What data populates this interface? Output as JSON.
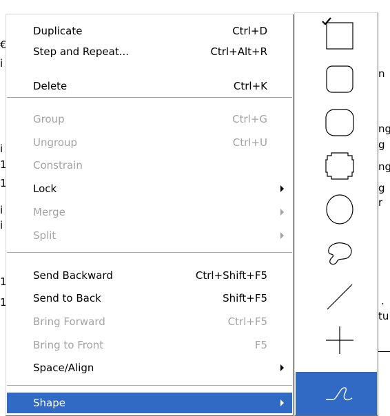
{
  "background_text": {
    "left_chars": [
      "€",
      "i",
      "i",
      "i",
      "i",
      "1",
      "1",
      "1",
      "1"
    ],
    "right_chars": [
      "n",
      "ng",
      "g",
      "ng",
      "g",
      "r",
      ".",
      "tu"
    ]
  },
  "menu": {
    "items": [
      {
        "label": "Duplicate",
        "shortcut": "Ctrl+D",
        "enabled": true
      },
      {
        "label": "Step and Repeat...",
        "shortcut": "Ctrl+Alt+R",
        "enabled": true
      },
      {
        "label": "Delete",
        "shortcut": "Ctrl+K",
        "enabled": true
      },
      {
        "label": "Group",
        "shortcut": "Ctrl+G",
        "enabled": false
      },
      {
        "label": "Ungroup",
        "shortcut": "Ctrl+U",
        "enabled": false
      },
      {
        "label": "Constrain",
        "shortcut": "",
        "enabled": false
      },
      {
        "label": "Lock",
        "shortcut": "",
        "enabled": true,
        "submenu": true
      },
      {
        "label": "Merge",
        "shortcut": "",
        "enabled": false,
        "submenu": true
      },
      {
        "label": "Split",
        "shortcut": "",
        "enabled": false,
        "submenu": true
      },
      {
        "label": "Send Backward",
        "shortcut": "Ctrl+Shift+F5",
        "enabled": true
      },
      {
        "label": "Send to Back",
        "shortcut": "Shift+F5",
        "enabled": true
      },
      {
        "label": "Bring Forward",
        "shortcut": "Ctrl+F5",
        "enabled": false
      },
      {
        "label": "Bring to Front",
        "shortcut": "F5",
        "enabled": false
      },
      {
        "label": "Space/Align",
        "shortcut": "",
        "enabled": true,
        "submenu": true
      },
      {
        "label": "Shape",
        "shortcut": "",
        "enabled": true,
        "submenu": true,
        "highlighted": true
      }
    ]
  },
  "submenu": {
    "items": [
      {
        "icon": "rectangle-shape-icon",
        "checked": true
      },
      {
        "icon": "rounded-rectangle-shape-icon",
        "checked": false
      },
      {
        "icon": "rounded-rectangle-large-shape-icon",
        "checked": false
      },
      {
        "icon": "beveled-rectangle-shape-icon",
        "checked": false
      },
      {
        "icon": "ellipse-shape-icon",
        "checked": false
      },
      {
        "icon": "freeform-blob-shape-icon",
        "checked": false
      },
      {
        "icon": "line-shape-icon",
        "checked": false
      },
      {
        "icon": "crosshair-shape-icon",
        "checked": false
      },
      {
        "icon": "curve-shape-icon",
        "checked": false,
        "highlighted": true
      }
    ]
  },
  "colors": {
    "highlight": "#316ac5",
    "disabled_text": "#a3a3a3",
    "separator": "#a7a7a7"
  }
}
